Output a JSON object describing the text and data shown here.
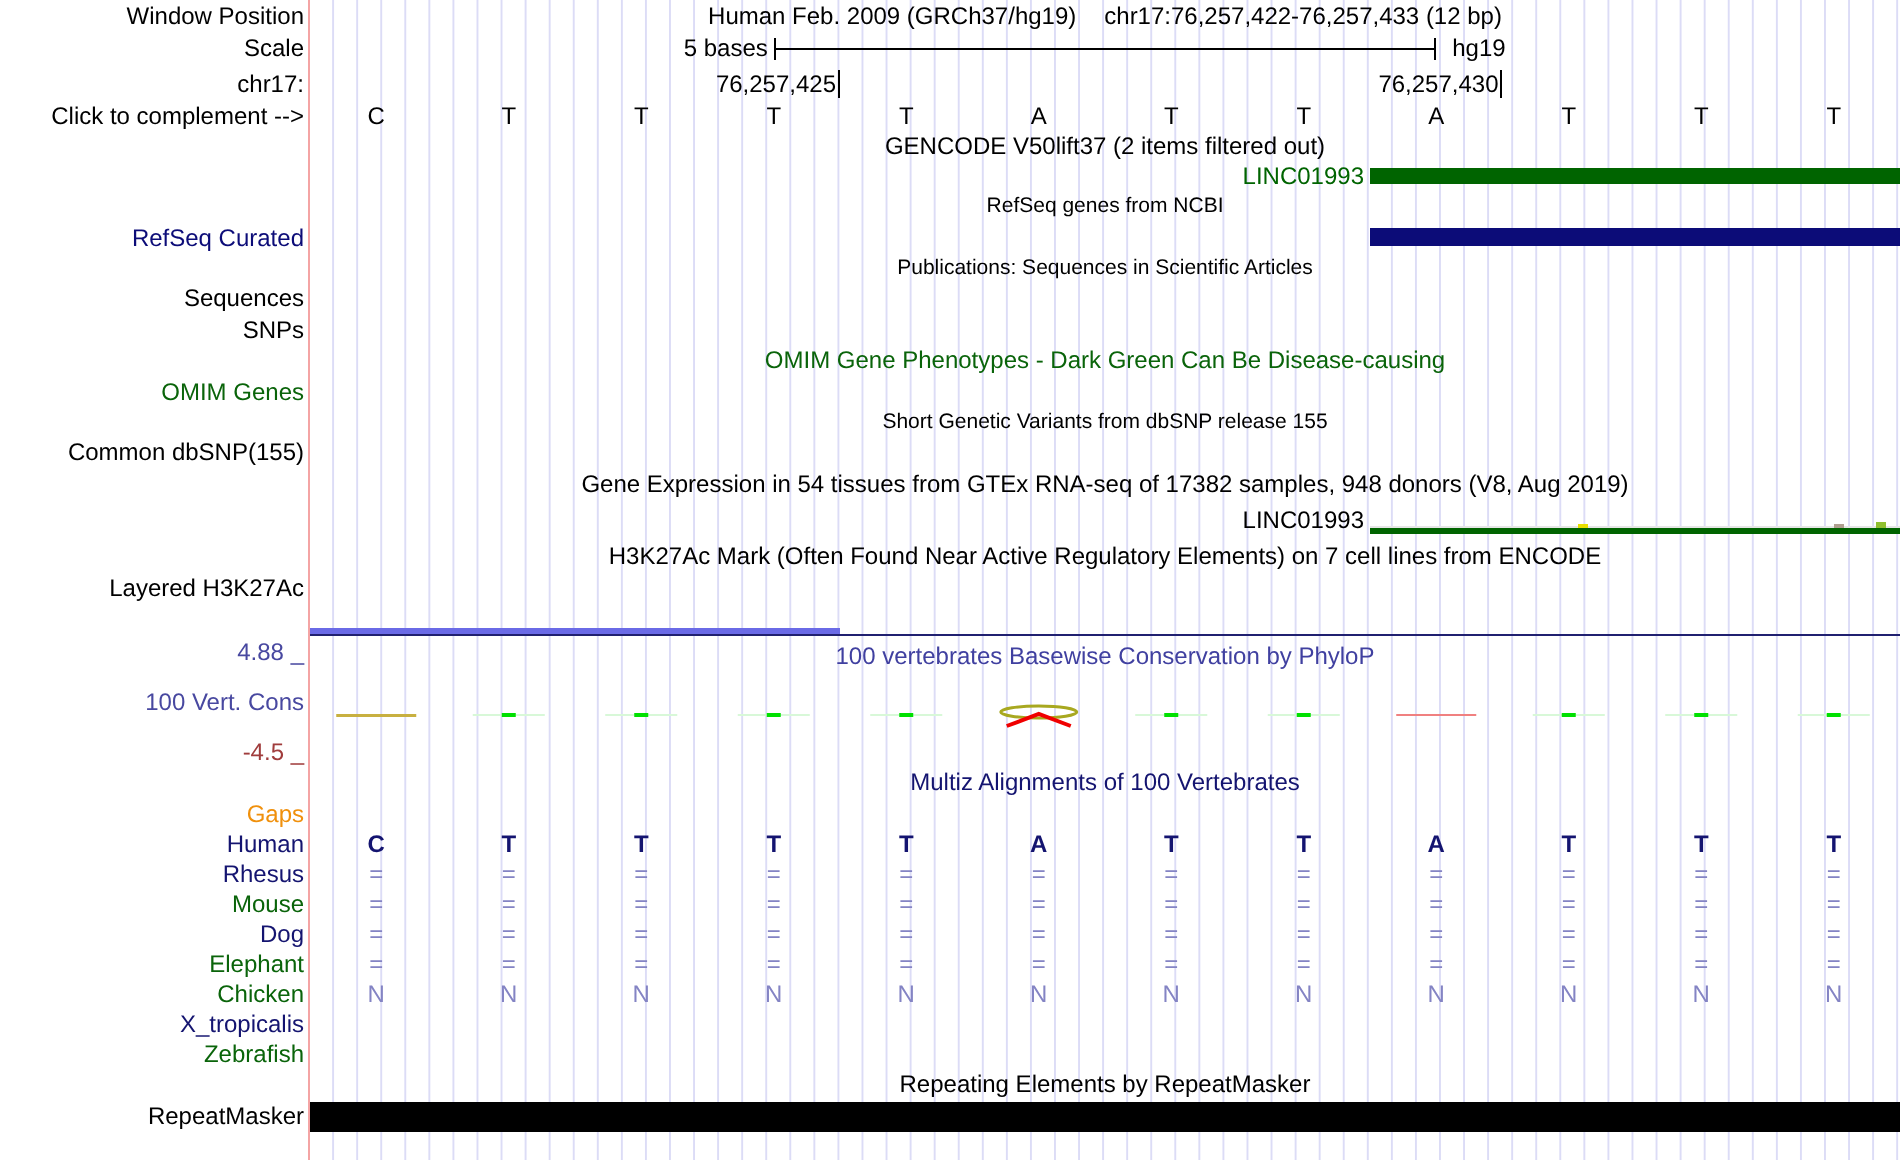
{
  "rows": [
    {
      "kind": "position",
      "label": "Window Position",
      "assembly": "Human Feb. 2009 (GRCh37/hg19)",
      "range": "chr17:76,257,422-76,257,433 (12 bp)"
    },
    {
      "kind": "scale",
      "label": "Scale",
      "length": "5 bases",
      "assembly": "hg19"
    },
    {
      "kind": "ruler",
      "label": "chr17:",
      "ticks": [
        "76,257,425",
        "76,257,430"
      ]
    },
    {
      "kind": "bases",
      "label": "Click to complement -->",
      "bases": [
        "C",
        "T",
        "T",
        "T",
        "T",
        "A",
        "T",
        "T",
        "A",
        "T",
        "T",
        "T"
      ]
    },
    {
      "kind": "title",
      "text": "GENCODE V50lift37 (2 items filtered out)"
    },
    {
      "kind": "gene",
      "name": "LINC01993",
      "color": "#006400"
    },
    {
      "kind": "caption",
      "text": "RefSeq genes from NCBI"
    },
    {
      "kind": "bar",
      "label": "RefSeq Curated",
      "color": "#0c0c78"
    },
    {
      "kind": "caption",
      "text": "Publications: Sequences in Scientific Articles"
    },
    {
      "kind": "label",
      "label": "Sequences"
    },
    {
      "kind": "label",
      "label": "SNPs"
    },
    {
      "kind": "title",
      "text": "OMIM Gene Phenotypes - Dark Green Can Be Disease-causing",
      "color": "#0a640a"
    },
    {
      "kind": "label",
      "label": "OMIM Genes",
      "color": "#0a640a"
    },
    {
      "kind": "caption",
      "text": "Short Genetic Variants from dbSNP release 155"
    },
    {
      "kind": "label",
      "label": "Common dbSNP(155)"
    },
    {
      "kind": "title",
      "text": "Gene Expression in 54 tissues from GTEx RNA-seq of 17382 samples, 948 donors (V8, Aug 2019)"
    },
    {
      "kind": "expression",
      "name": "LINC01993",
      "color": "#006400"
    },
    {
      "kind": "title",
      "text": "H3K27Ac Mark (Often Found Near Active Regulatory Elements) on 7 cell lines from ENCODE"
    },
    {
      "kind": "label",
      "label": "Layered H3K27Ac"
    },
    {
      "kind": "conservation",
      "label": "100 Vert. Cons",
      "color": "#4848a0",
      "max": "4.88 _",
      "min": "-4.5 _",
      "title": "100 vertebrates Basewise Conservation by PhyloP"
    },
    {
      "kind": "title",
      "text": "Multiz Alignments of 100 Vertebrates",
      "color": "#141470"
    },
    {
      "kind": "label",
      "label": "Gaps",
      "color": "#f0900c"
    },
    {
      "kind": "reference",
      "label": "Human",
      "color": "#141470",
      "bases": [
        "C",
        "T",
        "T",
        "T",
        "T",
        "A",
        "T",
        "T",
        "A",
        "T",
        "T",
        "T"
      ]
    },
    {
      "kind": "species",
      "label": "Rhesus",
      "color": "#141470",
      "bases": [
        "=",
        "=",
        "=",
        "=",
        "=",
        "=",
        "=",
        "=",
        "=",
        "=",
        "=",
        "="
      ]
    },
    {
      "kind": "species",
      "label": "Mouse",
      "color": "#0a640a",
      "bases": [
        "=",
        "=",
        "=",
        "=",
        "=",
        "=",
        "=",
        "=",
        "=",
        "=",
        "=",
        "="
      ]
    },
    {
      "kind": "species",
      "label": "Dog",
      "color": "#141470",
      "bases": [
        "=",
        "=",
        "=",
        "=",
        "=",
        "=",
        "=",
        "=",
        "=",
        "=",
        "=",
        "="
      ]
    },
    {
      "kind": "species",
      "label": "Elephant",
      "color": "#0a640a",
      "bases": [
        "=",
        "=",
        "=",
        "=",
        "=",
        "=",
        "=",
        "=",
        "=",
        "=",
        "=",
        "="
      ]
    },
    {
      "kind": "species",
      "label": "Chicken",
      "color": "#0a640a",
      "bases": [
        "N",
        "N",
        "N",
        "N",
        "N",
        "N",
        "N",
        "N",
        "N",
        "N",
        "N",
        "N"
      ]
    },
    {
      "kind": "species",
      "label": "X_tropicalis",
      "color": "#141470"
    },
    {
      "kind": "species",
      "label": "Zebrafish",
      "color": "#0a640a"
    },
    {
      "kind": "title",
      "text": "Repeating Elements by RepeatMasker"
    },
    {
      "kind": "repeat",
      "label": "RepeatMasker",
      "color": "#000000"
    }
  ]
}
